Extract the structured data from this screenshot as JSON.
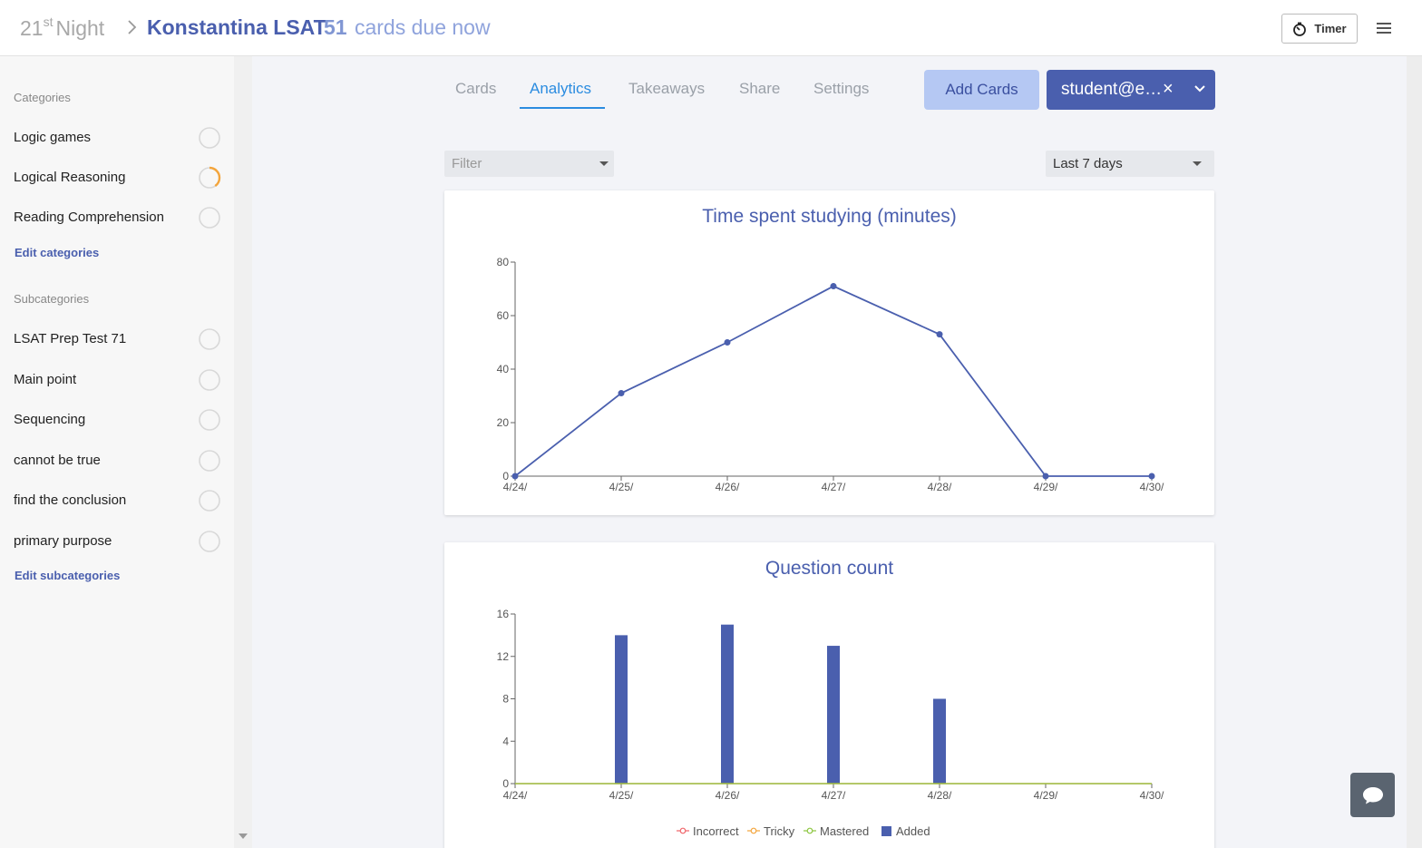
{
  "header": {
    "brand": "Night",
    "brand_num": "21",
    "brand_sup": "st",
    "deck_title": "Konstantina LSAT",
    "due_count": "51",
    "due_text": "cards due now",
    "timer_label": "Timer"
  },
  "sidebar": {
    "categories_title": "Categories",
    "categories": [
      {
        "label": "Logic games",
        "progress": 0
      },
      {
        "label": "Logical Reasoning",
        "progress": 0.4
      },
      {
        "label": "Reading Comprehension",
        "progress": 0
      }
    ],
    "edit_categories": "Edit categories",
    "subcategories_title": "Subcategories",
    "subcategories": [
      {
        "label": "LSAT Prep Test 71",
        "progress": 0
      },
      {
        "label": "Main point",
        "progress": 0
      },
      {
        "label": "Sequencing",
        "progress": 0
      },
      {
        "label": "cannot be true",
        "progress": 0
      },
      {
        "label": "find the conclusion",
        "progress": 0
      },
      {
        "label": "primary purpose",
        "progress": 0
      }
    ],
    "edit_subcategories": "Edit subcategories"
  },
  "tabs": [
    {
      "label": "Cards",
      "active": false
    },
    {
      "label": "Analytics",
      "active": true
    },
    {
      "label": "Takeaways",
      "active": false
    },
    {
      "label": "Share",
      "active": false
    },
    {
      "label": "Settings",
      "active": false
    }
  ],
  "actions": {
    "add_cards": "Add Cards",
    "user": "student@e…",
    "remove": "×"
  },
  "filters": {
    "filter_placeholder": "Filter",
    "range_value": "Last 7 days"
  },
  "colors": {
    "primary": "#4a5fae",
    "accent": "#2b8ce0",
    "incorrect": "#f0656a",
    "tricky": "#f3a53c",
    "mastered": "#8cc63f",
    "added": "#4a5fae",
    "ring_progress": "#f3a53c"
  },
  "chart_data": [
    {
      "type": "line",
      "title": "Time spent studying (minutes)",
      "x": [
        "4/24/",
        "4/25/",
        "4/26/",
        "4/27/",
        "4/28/",
        "4/29/",
        "4/30/"
      ],
      "series": [
        {
          "values": [
            0,
            31,
            50,
            71,
            53,
            0,
            0
          ]
        }
      ],
      "ylim": [
        0,
        80
      ],
      "yticks": [
        0,
        20,
        40,
        60,
        80
      ],
      "grid": false
    },
    {
      "type": "bar",
      "title": "Question count",
      "categories": [
        "4/24/",
        "4/25/",
        "4/26/",
        "4/27/",
        "4/28/",
        "4/29/",
        "4/30/"
      ],
      "series": [
        {
          "name": "Incorrect",
          "kind": "line",
          "values": [
            0,
            0,
            0,
            0,
            0,
            0,
            0
          ]
        },
        {
          "name": "Tricky",
          "kind": "line",
          "values": [
            0,
            0,
            0,
            0,
            0,
            0,
            0
          ]
        },
        {
          "name": "Mastered",
          "kind": "line",
          "values": [
            0,
            0,
            0,
            0,
            0,
            0,
            0
          ]
        },
        {
          "name": "Added",
          "kind": "bar",
          "values": [
            0,
            14,
            15,
            13,
            8,
            0,
            0
          ]
        }
      ],
      "ylim": [
        0,
        16
      ],
      "yticks": [
        0,
        4,
        8,
        12,
        16
      ],
      "legend": "bottom-center",
      "grid": false
    }
  ]
}
